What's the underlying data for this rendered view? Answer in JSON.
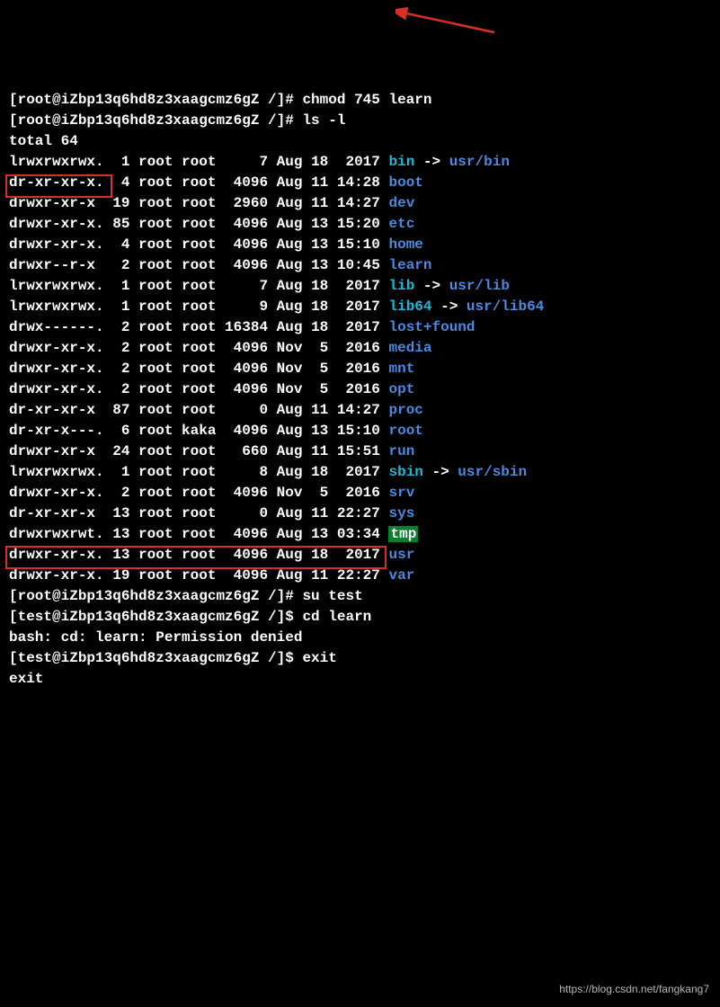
{
  "prompt1": {
    "user": "root",
    "host": "iZbp13q6hd8z3xaagcmz6gZ",
    "path": "/",
    "sym": "#",
    "cmd": "chmod 745 learn"
  },
  "prompt2": {
    "user": "root",
    "host": "iZbp13q6hd8z3xaagcmz6gZ",
    "path": "/",
    "sym": "#",
    "cmd": "ls -l"
  },
  "total": "total 64",
  "rows": [
    {
      "perm": "lrwxrwxrwx.",
      "lnk": "1",
      "own": "root",
      "grp": "root",
      "size": "7",
      "mon": "Aug",
      "day": "18",
      "time": "2017",
      "name": "bin",
      "link": "usr/bin"
    },
    {
      "perm": "dr-xr-xr-x.",
      "lnk": "4",
      "own": "root",
      "grp": "root",
      "size": "4096",
      "mon": "Aug",
      "day": "11",
      "time": "14:28",
      "name": "boot"
    },
    {
      "perm": "drwxr-xr-x",
      "lnk": "19",
      "own": "root",
      "grp": "root",
      "size": "2960",
      "mon": "Aug",
      "day": "11",
      "time": "14:27",
      "name": "dev"
    },
    {
      "perm": "drwxr-xr-x.",
      "lnk": "85",
      "own": "root",
      "grp": "root",
      "size": "4096",
      "mon": "Aug",
      "day": "13",
      "time": "15:20",
      "name": "etc"
    },
    {
      "perm": "drwxr-xr-x.",
      "lnk": "4",
      "own": "root",
      "grp": "root",
      "size": "4096",
      "mon": "Aug",
      "day": "13",
      "time": "15:10",
      "name": "home"
    },
    {
      "perm": "drwxr--r-x",
      "lnk": "2",
      "own": "root",
      "grp": "root",
      "size": "4096",
      "mon": "Aug",
      "day": "13",
      "time": "10:45",
      "name": "learn"
    },
    {
      "perm": "lrwxrwxrwx.",
      "lnk": "1",
      "own": "root",
      "grp": "root",
      "size": "7",
      "mon": "Aug",
      "day": "18",
      "time": "2017",
      "name": "lib",
      "link": "usr/lib"
    },
    {
      "perm": "lrwxrwxrwx.",
      "lnk": "1",
      "own": "root",
      "grp": "root",
      "size": "9",
      "mon": "Aug",
      "day": "18",
      "time": "2017",
      "name": "lib64",
      "link": "usr/lib64"
    },
    {
      "perm": "drwx------.",
      "lnk": "2",
      "own": "root",
      "grp": "root",
      "size": "16384",
      "mon": "Aug",
      "day": "18",
      "time": "2017",
      "name": "lost+found"
    },
    {
      "perm": "drwxr-xr-x.",
      "lnk": "2",
      "own": "root",
      "grp": "root",
      "size": "4096",
      "mon": "Nov",
      "day": "5",
      "time": "2016",
      "name": "media"
    },
    {
      "perm": "drwxr-xr-x.",
      "lnk": "2",
      "own": "root",
      "grp": "root",
      "size": "4096",
      "mon": "Nov",
      "day": "5",
      "time": "2016",
      "name": "mnt"
    },
    {
      "perm": "drwxr-xr-x.",
      "lnk": "2",
      "own": "root",
      "grp": "root",
      "size": "4096",
      "mon": "Nov",
      "day": "5",
      "time": "2016",
      "name": "opt"
    },
    {
      "perm": "dr-xr-xr-x",
      "lnk": "87",
      "own": "root",
      "grp": "root",
      "size": "0",
      "mon": "Aug",
      "day": "11",
      "time": "14:27",
      "name": "proc"
    },
    {
      "perm": "dr-xr-x---.",
      "lnk": "6",
      "own": "root",
      "grp": "kaka",
      "size": "4096",
      "mon": "Aug",
      "day": "13",
      "time": "15:10",
      "name": "root"
    },
    {
      "perm": "drwxr-xr-x",
      "lnk": "24",
      "own": "root",
      "grp": "root",
      "size": "660",
      "mon": "Aug",
      "day": "11",
      "time": "15:51",
      "name": "run"
    },
    {
      "perm": "lrwxrwxrwx.",
      "lnk": "1",
      "own": "root",
      "grp": "root",
      "size": "8",
      "mon": "Aug",
      "day": "18",
      "time": "2017",
      "name": "sbin",
      "link": "usr/sbin"
    },
    {
      "perm": "drwxr-xr-x.",
      "lnk": "2",
      "own": "root",
      "grp": "root",
      "size": "4096",
      "mon": "Nov",
      "day": "5",
      "time": "2016",
      "name": "srv"
    },
    {
      "perm": "dr-xr-xr-x",
      "lnk": "13",
      "own": "root",
      "grp": "root",
      "size": "0",
      "mon": "Aug",
      "day": "11",
      "time": "22:27",
      "name": "sys"
    },
    {
      "perm": "drwxrwxrwt.",
      "lnk": "13",
      "own": "root",
      "grp": "root",
      "size": "4096",
      "mon": "Aug",
      "day": "13",
      "time": "03:34",
      "name": "tmp",
      "tmp": true
    },
    {
      "perm": "drwxr-xr-x.",
      "lnk": "13",
      "own": "root",
      "grp": "root",
      "size": "4096",
      "mon": "Aug",
      "day": "18",
      "time": "2017",
      "name": "usr"
    },
    {
      "perm": "drwxr-xr-x.",
      "lnk": "19",
      "own": "root",
      "grp": "root",
      "size": "4096",
      "mon": "Aug",
      "day": "11",
      "time": "22:27",
      "name": "var"
    }
  ],
  "prompt3": {
    "user": "root",
    "host": "iZbp13q6hd8z3xaagcmz6gZ",
    "path": "/",
    "sym": "#",
    "cmd": "su test"
  },
  "prompt4": {
    "user": "test",
    "host": "iZbp13q6hd8z3xaagcmz6gZ",
    "path": "/",
    "sym": "$",
    "cmd": "cd learn"
  },
  "error": "bash: cd: learn: Permission denied",
  "prompt5": {
    "user": "test",
    "host": "iZbp13q6hd8z3xaagcmz6gZ",
    "path": "/",
    "sym": "$",
    "cmd": "exit"
  },
  "exit": "exit",
  "arrow_sep": " -> ",
  "watermark": "https://blog.csdn.net/fangkang7"
}
